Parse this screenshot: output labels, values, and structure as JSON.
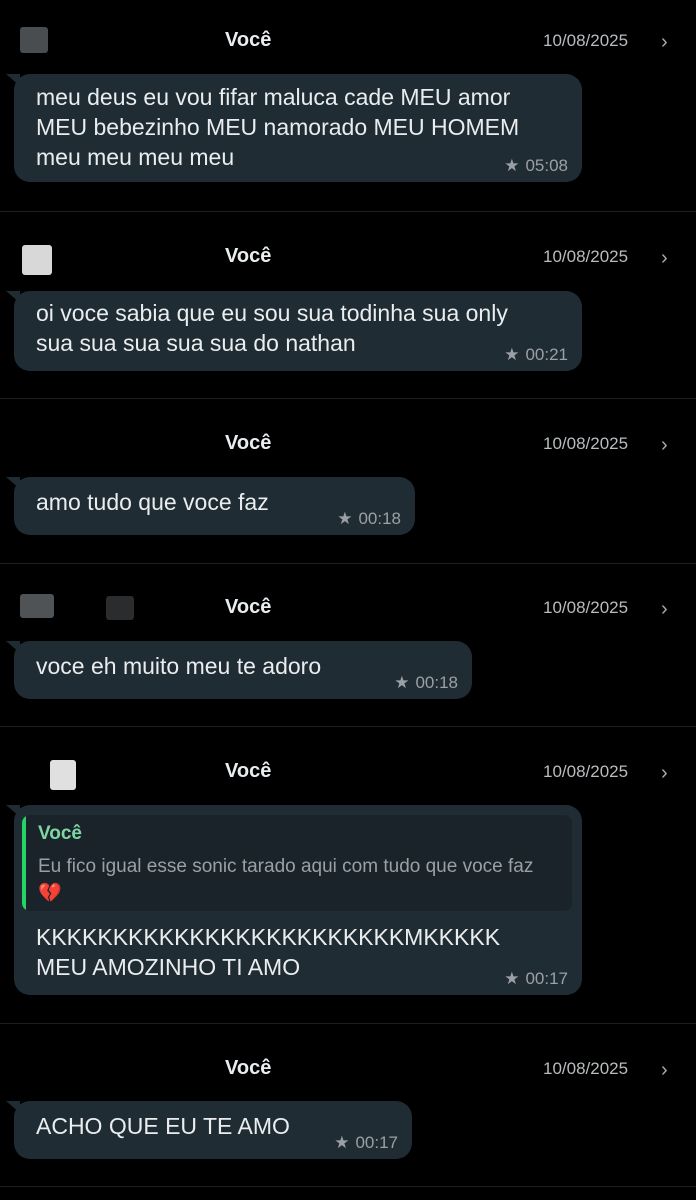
{
  "colors": {
    "background": "#000000",
    "bubble": "#202c33",
    "quote_accent": "#25d366"
  },
  "icons": {
    "star": "★",
    "chevron": "›",
    "broken_heart": "💔"
  },
  "entries": [
    {
      "sender": "Você",
      "date": "10/08/2025",
      "text": "meu deus eu vou fifar maluca cade MEU amor\nMEU bebezinho MEU namorado MEU HOMEM\nmeu meu meu meu",
      "time": "05:08"
    },
    {
      "sender": "Você",
      "date": "10/08/2025",
      "text": "oi voce sabia que eu sou sua todinha sua only\nsua sua sua sua sua do nathan",
      "time": "00:21"
    },
    {
      "sender": "Você",
      "date": "10/08/2025",
      "text": "amo tudo que voce faz",
      "time": "00:18"
    },
    {
      "sender": "Você",
      "date": "10/08/2025",
      "text": "voce eh muito meu te adoro",
      "time": "00:18"
    },
    {
      "sender": "Você",
      "date": "10/08/2025",
      "quote_author": "Você",
      "quote_text": "Eu fico igual esse sonic tarado aqui com tudo que voce faz",
      "text": "KKKKKKKKKKKKKKKKKKKKKKKKMKKKKK\nMEU AMOZINHO TI AMO",
      "time": "00:17"
    },
    {
      "sender": "Você",
      "date": "10/08/2025",
      "text": "ACHO QUE EU TE AMO",
      "time": "00:17"
    }
  ]
}
